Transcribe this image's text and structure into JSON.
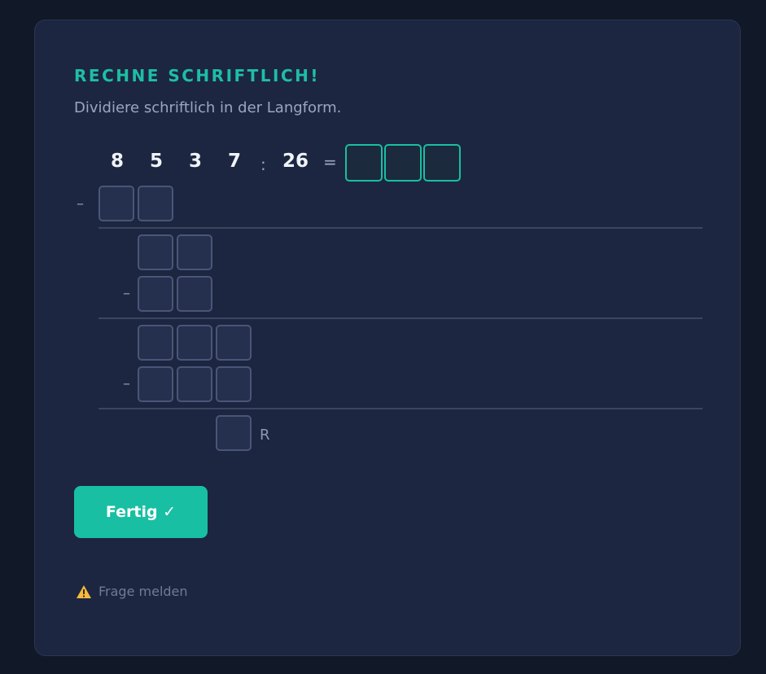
{
  "task": {
    "heading": "RECHNE SCHRIFTLICH!",
    "instruction": "Dividiere schriftlich in der Langform."
  },
  "equation": {
    "dividend_digits": [
      "8",
      "5",
      "3",
      "7"
    ],
    "divide_symbol": ":",
    "divisor": "26",
    "equals_symbol": "="
  },
  "work": {
    "minus_symbol": "–",
    "remainder_label": "R"
  },
  "actions": {
    "submit_label": "Fertig ✓",
    "report_label": "Frage melden"
  },
  "colors": {
    "accent": "#19bfa3",
    "background": "#111827",
    "card": "#1c2640",
    "input_box": "#25304f",
    "warning_icon": "#f5b942"
  }
}
